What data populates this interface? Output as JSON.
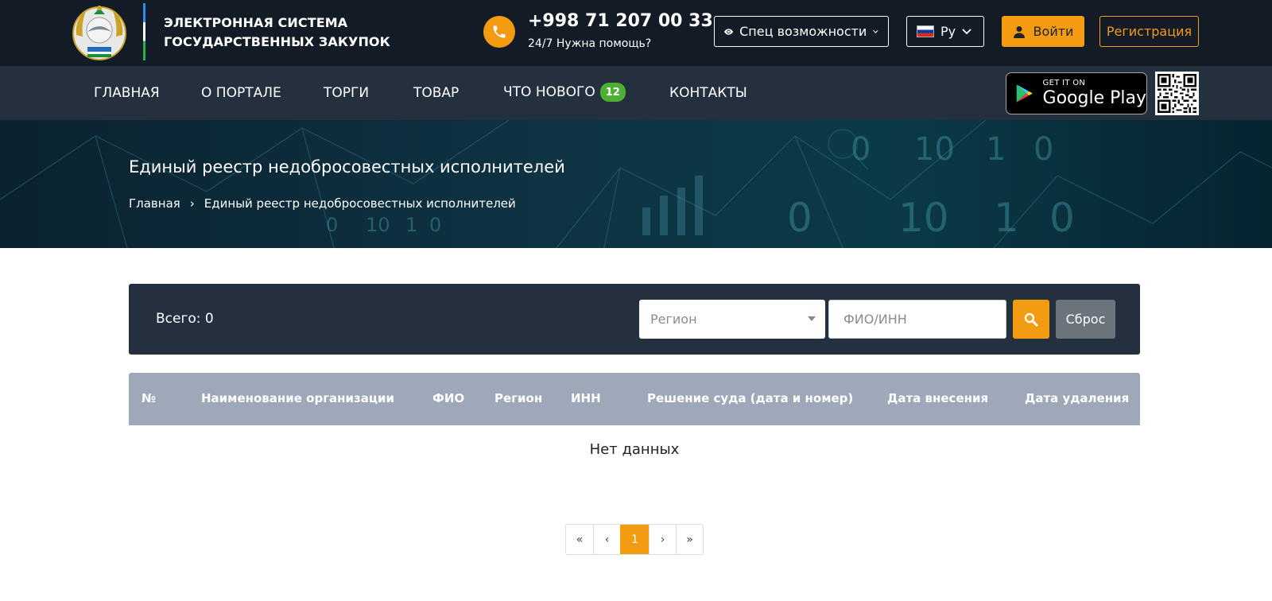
{
  "header": {
    "brand_line1": "ЭЛЕКТРОННАЯ СИСТЕМА",
    "brand_line2": "ГОСУДАРСТВЕННЫХ ЗАКУПОК",
    "phone": "+998 71 207 00 33",
    "help": "24/7 Нужна помощь?",
    "accessibility_label": "Спец возможности",
    "language_label": "Ру",
    "login_label": "Войти",
    "register_label": "Регистрация"
  },
  "nav": {
    "items": [
      {
        "label": "ГЛАВНАЯ"
      },
      {
        "label": "О ПОРТАЛЕ"
      },
      {
        "label": "ТОРГИ"
      },
      {
        "label": "ТОВАР"
      },
      {
        "label": "ЧТО НОВОГО",
        "badge": "12"
      },
      {
        "label": "КОНТАКТЫ"
      }
    ],
    "store_small": "GET IT ON",
    "store_big": "Google Play"
  },
  "banner": {
    "title": "Единый реестр недобросовестных исполнителей",
    "breadcrumbs": [
      "Главная",
      "›",
      "Единый реестр недобросовестных исполнителей"
    ],
    "decor_digits": [
      "0",
      "10",
      "1",
      "0",
      "0",
      "10",
      "1",
      "0",
      "0",
      "10",
      "1",
      "0"
    ]
  },
  "filter": {
    "total_label": "Всего: 0",
    "region_placeholder": "Регион",
    "fio_placeholder": "ФИО/ИНН",
    "reset_label": "Сброс"
  },
  "table": {
    "columns": [
      "№",
      "Наименование организации",
      "ФИО",
      "Регион",
      "ИНН",
      "Решение суда (дата и номер)",
      "Дата внесения",
      "Дата удаления"
    ],
    "empty_text": "Нет данных"
  },
  "pagination": {
    "first": "«",
    "prev": "‹",
    "current": "1",
    "next": "›",
    "last": "»"
  },
  "colors": {
    "accent": "#f39c12",
    "header_bg": "#131c26",
    "nav_bg": "#25303f",
    "table_header_bg": "#9ea8b8",
    "badge_green": "#4cb034"
  }
}
